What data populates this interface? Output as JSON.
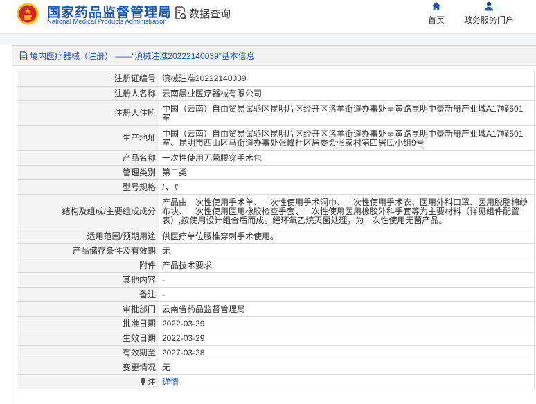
{
  "header": {
    "brand_cn": "国家药品监督管理局",
    "brand_en": "National Medical Products Administration",
    "query_label": "数据查询",
    "nav": {
      "home": "首页",
      "portal": "政务服务门户"
    }
  },
  "breadcrumb": "境内医疗器械（注册） ——“滇械注准20222140039”基本信息",
  "colors": {
    "brand_blue": "#1a56b0",
    "emblem_red": "#d0232a",
    "emblem_gold": "#f2c200"
  },
  "rows": [
    {
      "label": "注册证编号",
      "value": "滇械注准20222140039"
    },
    {
      "label": "注册人名称",
      "value": "云南晨业医疗器械有限公司"
    },
    {
      "label": "注册人住所",
      "value": "中国（云南）自由贸易试验区昆明片区经开区洛羊街道办事处呈黄路昆明中豪新册产业城A17幢501室"
    },
    {
      "label": "生产地址",
      "value": "中国（云南）自由贸易试验区昆明片区经开区洛羊街道办事处呈黄路昆明中豪新册产业城A17幢501室、昆明市西山区马街道办事处张峰社区居委会张家村第四居民小组9号"
    },
    {
      "label": "产品名称",
      "value": "一次性使用无菌腰穿手术包"
    },
    {
      "label": "管理类别",
      "value": "第二类"
    },
    {
      "label": "型号规格",
      "value": "Ⅰ、Ⅱ"
    },
    {
      "label": "结构及组成/主要组成成分",
      "value": "产品由一次性使用手术单、一次性使用手术洞巾、一次性使用手术衣、医用外科口罩、医用脱脂棉纱布块、一次性使用医用橡胶检查手套、一次性使用医用橡胶外科手套等为主要材料（详见组件配置表）,按使用设计组合后而成。经环氧乙烷灭菌处理，为一次性使用无菌产品。"
    },
    {
      "label": "适用范围/预期用途",
      "value": "供医疗单位腰椎穿刺手术使用。"
    },
    {
      "label": "产品储存条件及有效期",
      "value": "无"
    },
    {
      "label": "附件",
      "value": "产品技术要求"
    },
    {
      "label": "其他内容",
      "value": "-"
    },
    {
      "label": "备注",
      "value": "-"
    },
    {
      "label": "审批部门",
      "value": "云南省药品监督管理局"
    },
    {
      "label": "批准日期",
      "value": "2022-03-29"
    },
    {
      "label": "生效日期",
      "value": "2022-03-29"
    },
    {
      "label": "有效期至",
      "value": "2027-03-28"
    },
    {
      "label": "变更情况",
      "value": "无"
    },
    {
      "label": "注",
      "value": "详情"
    }
  ]
}
